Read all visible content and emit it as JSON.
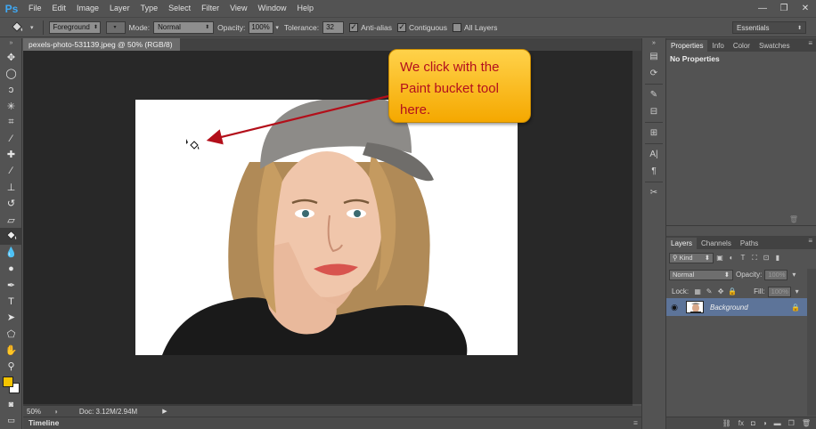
{
  "app": {
    "logo": "Ps"
  },
  "menu": [
    "File",
    "Edit",
    "Image",
    "Layer",
    "Type",
    "Select",
    "Filter",
    "View",
    "Window",
    "Help"
  ],
  "window_controls": {
    "minimize": "—",
    "restore": "❐",
    "close": "✕"
  },
  "options": {
    "fill_source": "Foreground",
    "mode_label": "Mode:",
    "mode_value": "Normal",
    "opacity_label": "Opacity:",
    "opacity_value": "100%",
    "tolerance_label": "Tolerance:",
    "tolerance_value": "32",
    "antialias_label": "Anti-alias",
    "contiguous_label": "Contiguous",
    "all_layers_label": "All Layers",
    "workspace": "Essentials"
  },
  "document": {
    "tab_title": "pexels-photo-531139.jpeg @ 50% (RGB/8) *",
    "tab_close": "×"
  },
  "status": {
    "zoom": "50%",
    "doc": "Doc: 3.12M/2.94M"
  },
  "timeline": {
    "label": "Timeline"
  },
  "panels": {
    "top_tabs": [
      "Properties",
      "Info",
      "Color",
      "Swatches"
    ],
    "properties_text": "No Properties",
    "layer_tabs": [
      "Layers",
      "Channels",
      "Paths"
    ],
    "kind_label": "Kind",
    "blend_mode": "Normal",
    "opacity_label": "Opacity:",
    "opacity_value": "100%",
    "lock_label": "Lock:",
    "fill_label": "Fill:",
    "fill_value": "100%",
    "layer_name": "Background"
  },
  "callout": {
    "text": "We click with the Paint bucket tool here."
  },
  "colors": {
    "foreground": "#f5c400",
    "background": "#ffffff",
    "callout_text": "#b3101e",
    "arrow": "#b30f1a",
    "selected_layer": "#5d7499"
  },
  "icons": {
    "active_tool": "paint-bucket-icon",
    "cursor": "paint-bucket-cursor-icon"
  }
}
